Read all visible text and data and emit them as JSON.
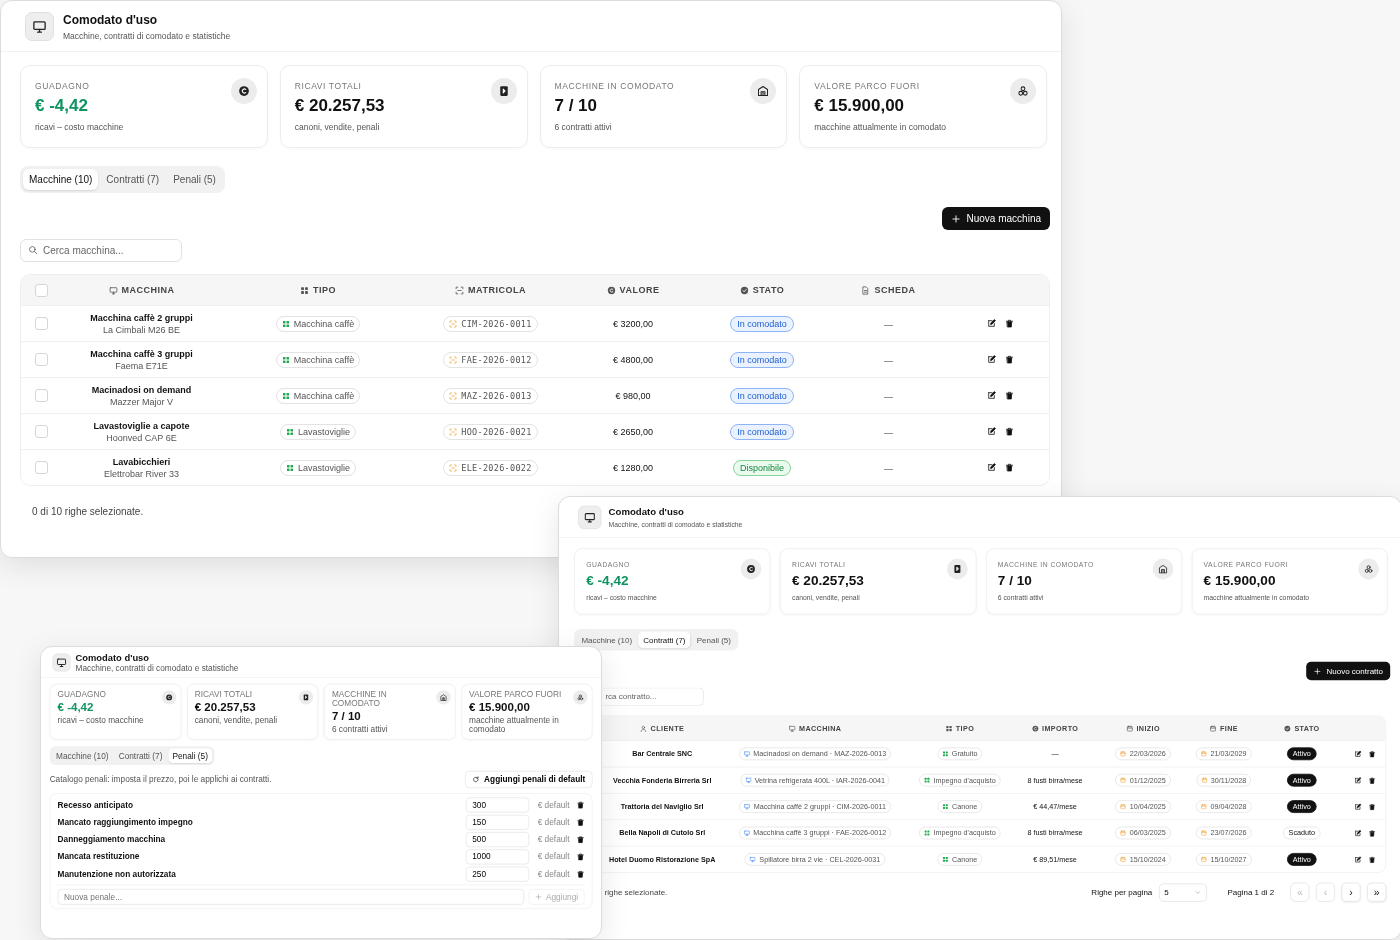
{
  "windows": [
    {
      "kind": "machines",
      "header": {
        "title": "Comodato d'uso",
        "subtitle": "Macchine, contratti di comodato e statistiche"
      },
      "stats": [
        {
          "label": "GUADAGNO",
          "value": "€ -4,42",
          "note": "ricavi – costo macchine",
          "highlight": true
        },
        {
          "label": "RICAVI TOTALI",
          "value": "€ 20.257,53",
          "note": "canoni, vendite, penali",
          "highlight": false
        },
        {
          "label": "MACCHINE IN COMODATO",
          "value": "7 / 10",
          "note": "6 contratti attivi",
          "highlight": false
        },
        {
          "label": "VALORE PARCO FUORI",
          "value": "€ 15.900,00",
          "note": "macchine attualmente in comodato",
          "highlight": false
        }
      ],
      "tabs": [
        {
          "label": "Macchine (10)",
          "selected": true
        },
        {
          "label": "Contratti (7)",
          "selected": false
        },
        {
          "label": "Penali (5)",
          "selected": false
        }
      ],
      "action": "Nuova macchina",
      "search": {
        "placeholder": "Cerca macchina..."
      },
      "table": {
        "header_checked": false,
        "columns": [
          "MACCHINA",
          "TIPO",
          "MATRICOLA",
          "VALORE",
          "STATO",
          "SCHEDA"
        ],
        "rows": [
          {
            "checked": false,
            "name": "Macchina caffè 2 gruppi",
            "model": "La Cimbali M26 BE",
            "type": "Macchina caffè",
            "serial": "CIM-2026-0011",
            "value": "€ 3200,00",
            "status": {
              "label": "In comodato",
              "kind": "info"
            },
            "sheet": "—"
          },
          {
            "checked": false,
            "name": "Macchina caffè 3 gruppi",
            "model": "Faema E71E",
            "type": "Macchina caffè",
            "serial": "FAE-2026-0012",
            "value": "€ 4800,00",
            "status": {
              "label": "In comodato",
              "kind": "info"
            },
            "sheet": "—"
          },
          {
            "checked": false,
            "name": "Macinadosi on demand",
            "model": "Mazzer Major V",
            "type": "Macchina caffè",
            "serial": "MAZ-2026-0013",
            "value": "€ 980,00",
            "status": {
              "label": "In comodato",
              "kind": "info"
            },
            "sheet": "—"
          },
          {
            "checked": false,
            "name": "Lavastoviglie a capote",
            "model": "Hoonved CAP 6E",
            "type": "Lavastoviglie",
            "serial": "HOO-2026-0021",
            "value": "€ 2650,00",
            "status": {
              "label": "In comodato",
              "kind": "info"
            },
            "sheet": "—"
          },
          {
            "checked": false,
            "name": "Lavabicchieri",
            "model": "Elettrobar River 33",
            "type": "Lavastoviglie",
            "serial": "ELE-2026-0022",
            "value": "€ 1280,00",
            "status": {
              "label": "Disponibile",
              "kind": "success"
            },
            "sheet": "—"
          }
        ]
      },
      "footer": "0 di 10 righe selezionate."
    },
    {
      "kind": "contracts",
      "header": {
        "title": "Comodato d'uso",
        "subtitle": "Macchine, contratti di comodato e statistiche"
      },
      "stats": [
        {
          "label": "GUADAGNO",
          "value": "€ -4,42",
          "note": "ricavi – costo macchine",
          "highlight": true
        },
        {
          "label": "RICAVI TOTALI",
          "value": "€ 20.257,53",
          "note": "canoni, vendite, penali",
          "highlight": false
        },
        {
          "label": "MACCHINE IN COMODATO",
          "value": "7 / 10",
          "note": "6 contratti attivi",
          "highlight": false
        },
        {
          "label": "VALORE PARCO FUORI",
          "value": "€ 15.900,00",
          "note": "macchine attualmente in comodato",
          "highlight": false
        }
      ],
      "tabs": [
        {
          "label": "Macchine (10)",
          "selected": false
        },
        {
          "label": "Contratti (7)",
          "selected": true
        },
        {
          "label": "Penali (5)",
          "selected": false
        }
      ],
      "action": "Nuovo contratto",
      "search": {
        "placeholder": "rca contratto..."
      },
      "table": {
        "columns": [
          "CLIENTE",
          "MACCHINA",
          "TIPO",
          "IMPORTO",
          "INIZIO",
          "FINE",
          "STATO"
        ],
        "rows": [
          {
            "client": "Bar Centrale SNC",
            "machine": "Macinadosi on demand · MAZ-2026-0013",
            "type": "Gratuito",
            "amount": "—",
            "start": "22/03/2026",
            "end": "21/03/2029",
            "status": {
              "label": "Attivo",
              "kind": "active"
            }
          },
          {
            "client": "Vecchia Fonderia Birreria Srl",
            "machine": "Vetrina refrigerata 400L · IAR-2026-0041",
            "type": "Impegno d'acquisto",
            "amount": "8 fusti birra/mese",
            "start": "01/12/2025",
            "end": "30/11/2028",
            "status": {
              "label": "Attivo",
              "kind": "active"
            }
          },
          {
            "client": "Trattoria del Naviglio Srl",
            "machine": "Macchina caffè 2 gruppi · CIM-2026-0011",
            "type": "Canone",
            "amount": "€ 44,47/mese",
            "start": "10/04/2025",
            "end": "09/04/2028",
            "status": {
              "label": "Attivo",
              "kind": "active"
            }
          },
          {
            "client": "Bella Napoli di Cutolo Srl",
            "machine": "Macchina caffè 3 gruppi · FAE-2026-0012",
            "type": "Impegno d'acquisto",
            "amount": "8 fusti birra/mese",
            "start": "06/03/2025",
            "end": "23/07/2026",
            "status": {
              "label": "Scaduto",
              "kind": "expired"
            }
          },
          {
            "client": "Hotel Duomo Ristorazione SpA",
            "machine": "Spillatore birra 2 vie · CEL-2026-0031",
            "type": "Canone",
            "amount": "€ 89,51/mese",
            "start": "15/10/2024",
            "end": "15/10/2027",
            "status": {
              "label": "Attivo",
              "kind": "active"
            }
          }
        ]
      },
      "footer": "righe selezionate.",
      "pagination": {
        "rows_label": "Righe per pagina",
        "page_size": "5",
        "page": "Pagina 1 di 2",
        "buttons": [
          {
            "label": "«",
            "disabled": true
          },
          {
            "label": "‹",
            "disabled": true
          },
          {
            "label": "›",
            "disabled": false
          },
          {
            "label": "»",
            "disabled": false
          }
        ]
      }
    },
    {
      "kind": "penalties",
      "header": {
        "title": "Comodato d'uso",
        "subtitle": "Macchine, contratti di comodato e statistiche"
      },
      "stats": [
        {
          "label": "GUADAGNO",
          "value": "€ -4,42",
          "note": "ricavi – costo macchine",
          "highlight": true
        },
        {
          "label": "RICAVI TOTALI",
          "value": "€ 20.257,53",
          "note": "canoni, vendite, penali",
          "highlight": false
        },
        {
          "label": "MACCHINE IN COMODATO",
          "value": "7 / 10",
          "note": "6 contratti attivi",
          "highlight": false
        },
        {
          "label": "VALORE PARCO FUORI",
          "value": "€ 15.900,00",
          "note": "macchine attualmente in comodato",
          "highlight": false
        }
      ],
      "tabs": [
        {
          "label": "Macchine (10)",
          "selected": false
        },
        {
          "label": "Contratti (7)",
          "selected": false
        },
        {
          "label": "Penali (5)",
          "selected": true
        }
      ],
      "intro": "Catalogo penali: imposta il prezzo, poi le applichi ai contratti.",
      "action": "Aggiungi penali di default",
      "penalties": [
        {
          "name": "Recesso anticipato",
          "amount": "300",
          "unit": "€ default"
        },
        {
          "name": "Mancato raggiungimento impegno",
          "amount": "150",
          "unit": "€ default"
        },
        {
          "name": "Danneggiamento macchina",
          "amount": "500",
          "unit": "€ default"
        },
        {
          "name": "Mancata restituzione",
          "amount": "1000",
          "unit": "€ default"
        },
        {
          "name": "Manutenzione non autorizzata",
          "amount": "250",
          "unit": "€ default"
        }
      ],
      "new_penalty": {
        "placeholder": "Nuova penale...",
        "button": "Aggiungi",
        "disabled": true
      }
    }
  ]
}
